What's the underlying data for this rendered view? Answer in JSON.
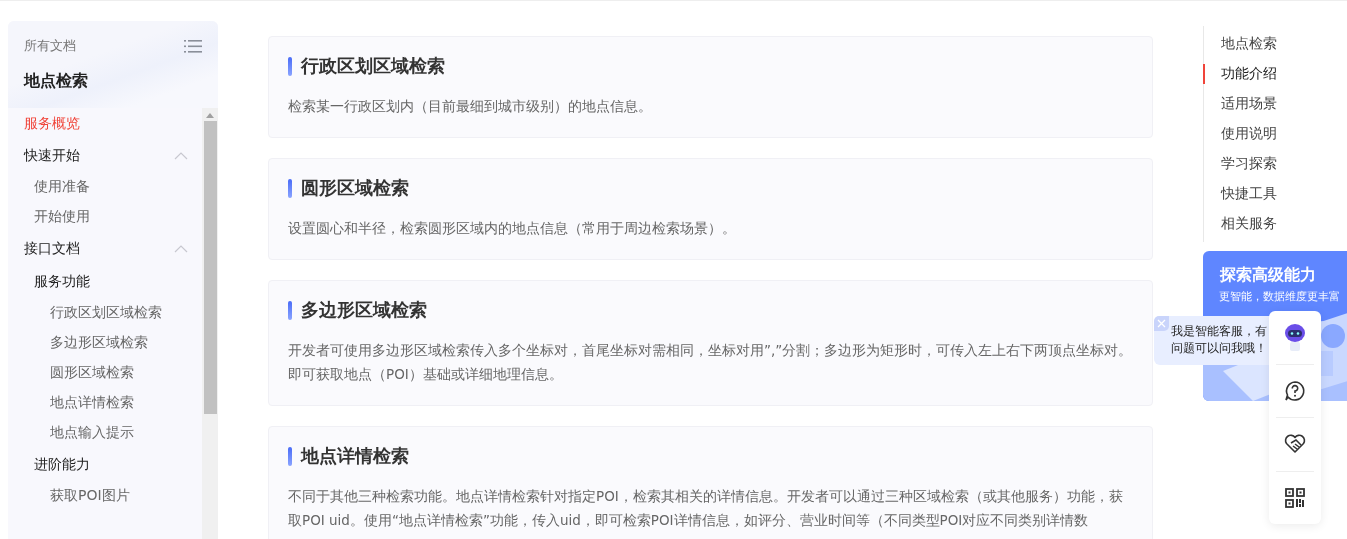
{
  "sidebar": {
    "label": "所有文档",
    "title": "地点检索",
    "items": [
      {
        "label": "服务概览",
        "kind": "link",
        "selected": true
      },
      {
        "label": "快速开始",
        "kind": "heading",
        "selected": false,
        "expanded": true,
        "children": [
          {
            "label": "使用准备",
            "kind": "link",
            "selected": false
          },
          {
            "label": "开始使用",
            "kind": "link",
            "selected": false
          }
        ]
      },
      {
        "label": "接口文档",
        "kind": "heading",
        "selected": false,
        "expanded": true,
        "children": [
          {
            "label": "服务功能",
            "kind": "heading",
            "selected": false,
            "children": [
              {
                "label": "行政区划区域检索",
                "kind": "link",
                "selected": false
              },
              {
                "label": "多边形区域检索",
                "kind": "link",
                "selected": false
              },
              {
                "label": "圆形区域检索",
                "kind": "link",
                "selected": false
              },
              {
                "label": "地点详情检索",
                "kind": "link",
                "selected": false
              },
              {
                "label": "地点输入提示",
                "kind": "link",
                "selected": false
              }
            ]
          },
          {
            "label": "进阶能力",
            "kind": "heading",
            "selected": false,
            "children": [
              {
                "label": "获取POI图片",
                "kind": "link",
                "selected": false
              }
            ]
          }
        ]
      }
    ]
  },
  "sections": [
    {
      "title": "行政区划区域检索",
      "text": "检索某一行政区划内（目前最细到城市级别）的地点信息。"
    },
    {
      "title": "圆形区域检索",
      "text": "设置圆心和半径，检索圆形区域内的地点信息（常用于周边检索场景）。"
    },
    {
      "title": "多边形区域检索",
      "text": "开发者可使用多边形区域检索传入多个坐标对，首尾坐标对需相同，坐标对用”,”分割；多边形为矩形时，可传入左上右下两顶点坐标对。即可获取地点（POI）基础或详细地理信息。"
    },
    {
      "title": "地点详情检索",
      "text": "不同于其他三种检索功能。地点详情检索针对指定POI，检索其相关的详情信息。开发者可以通过三种区域检索（或其他服务）功能，获取POI uid。使用“地点详情检索”功能，传入uid，即可检索POI详情信息，如评分、营业时间等（不同类型POI对应不同类别详情数"
    }
  ],
  "toc": [
    {
      "label": "地点检索",
      "selected": false
    },
    {
      "label": "功能介绍",
      "selected": true
    },
    {
      "label": "适用场景",
      "selected": false
    },
    {
      "label": "使用说明",
      "selected": false
    },
    {
      "label": "学习探索",
      "selected": false
    },
    {
      "label": "快捷工具",
      "selected": false
    },
    {
      "label": "相关服务",
      "selected": false
    }
  ],
  "promo": {
    "title": "探索高级能力",
    "subtitle": "更智能，数据维度更丰富"
  },
  "assistant_tip": {
    "text": "我是智能客服，有问题可以问我哦！"
  }
}
